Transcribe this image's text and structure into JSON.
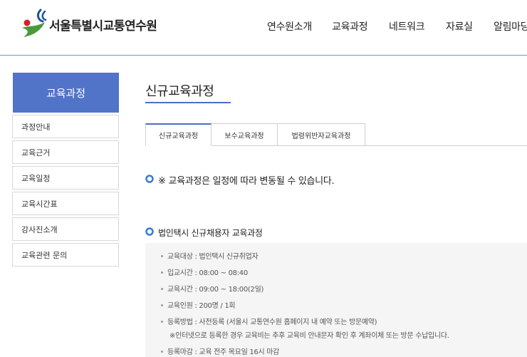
{
  "header": {
    "org_name": "서울특별시교통연수원",
    "nav": [
      "연수원소개",
      "교육과정",
      "네트워크",
      "자료실",
      "알림마당"
    ]
  },
  "sidebar": {
    "title": "교육과정",
    "items": [
      "과정안내",
      "교육근거",
      "교육일정",
      "교육시간표",
      "강사진소개",
      "교육관련 문의"
    ]
  },
  "main": {
    "page_title": "신규교육과정",
    "tabs": [
      "신규교육과정",
      "보수교육과정",
      "법령위반자교육과정"
    ],
    "active_tab": "신규교육과정",
    "notice": "※ 교육과정은 일정에 따라 변동될 수 있습니다.",
    "section_title": "법인택시 신규채용자 교육과정",
    "details": [
      "교육대상 : 법인택시 신규취업자",
      "입교시간 : 08:00 ~ 08:40",
      "교육시간 : 09:00 ~ 18:00(2일)",
      "교육인원 : 200명 / 1회",
      "등록방법 : 사전등록 (서울시 교통연수원 홈페이지 내 예약 또는 방문예약)",
      "등록마감 : 교육 전주 목요일 16시 마감"
    ],
    "detail_note": "※인터넷으로 등록한 경우 교육비는 추후 교육비 안내문자 확인 후 계좌이체 또는 방문 수납입니다."
  },
  "colors": {
    "accent": "#5173c8",
    "logo_blue": "#1e4fa5",
    "logo_red": "#d6202b",
    "logo_green": "#4a9a3a"
  }
}
